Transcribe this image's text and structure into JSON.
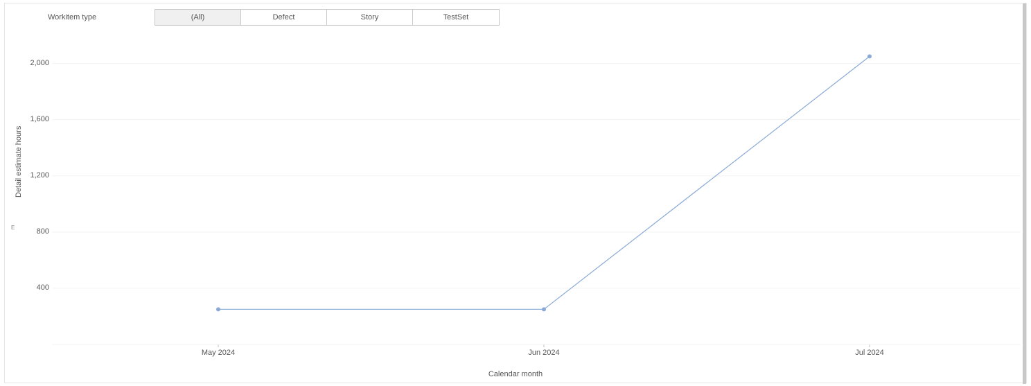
{
  "filter": {
    "label": "Workitem type",
    "tabs": [
      "(All)",
      "Defect",
      "Story",
      "TestSet"
    ],
    "selected_index": 0
  },
  "axes": {
    "ylabel": "Detail estimate hours",
    "xlabel": "Calendar month",
    "y_ticks": [
      "400",
      "800",
      "1,200",
      "1,600",
      "2,000"
    ],
    "x_ticks": [
      "May 2024",
      "Jun 2024",
      "Jul 2024"
    ]
  },
  "chart_data": {
    "type": "line",
    "categories": [
      "May 2024",
      "Jun 2024",
      "Jul 2024"
    ],
    "values": [
      250,
      250,
      2050
    ],
    "title": "",
    "xlabel": "Calendar month",
    "ylabel": "Detail estimate hours",
    "ylim": [
      0,
      2200
    ],
    "line_color": "#8aa9d6",
    "marker_color": "#8aa9d6"
  }
}
